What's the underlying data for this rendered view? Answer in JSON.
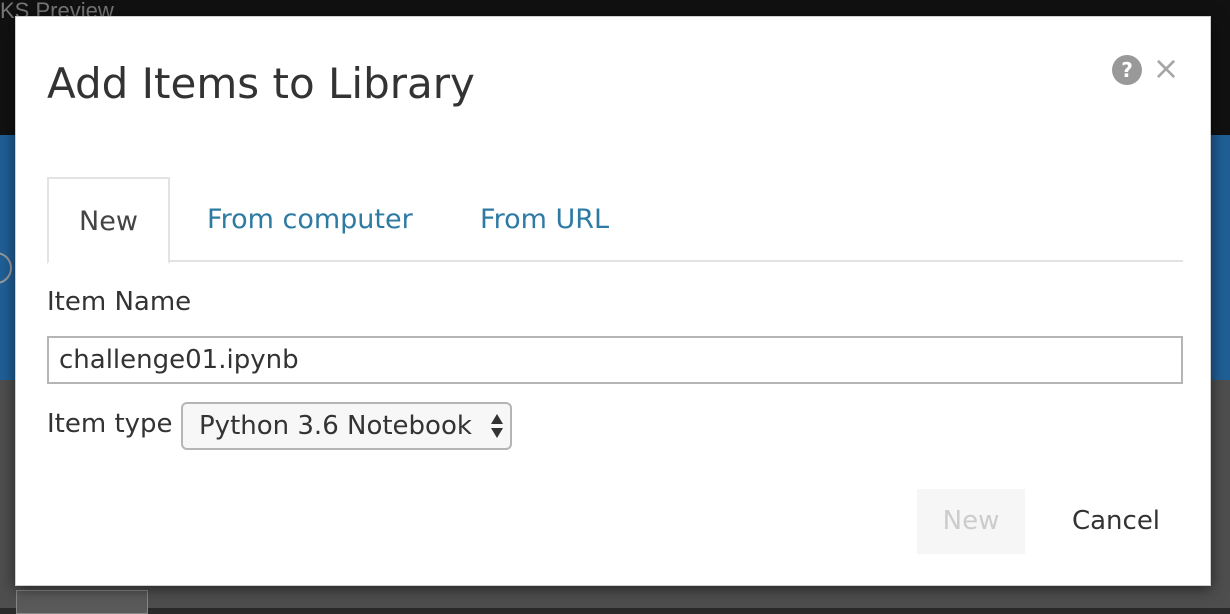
{
  "background": {
    "title_fragment": "KS Preview"
  },
  "dialog": {
    "title": "Add Items to Library",
    "help_icon": "?",
    "close_icon": "×"
  },
  "tabs": [
    {
      "label": "New",
      "active": true
    },
    {
      "label": "From computer",
      "active": false
    },
    {
      "label": "From URL",
      "active": false
    }
  ],
  "form": {
    "item_name_label": "Item Name",
    "item_name_value": "challenge01.ipynb",
    "item_type_label": "Item type",
    "item_type_selected": "Python 3.6 Notebook"
  },
  "buttons": {
    "new_label": "New",
    "new_disabled": true,
    "cancel_label": "Cancel"
  },
  "colors": {
    "link": "#2d7aa3",
    "background_blue": "#1f5f96",
    "disabled_text": "#cccccc"
  }
}
